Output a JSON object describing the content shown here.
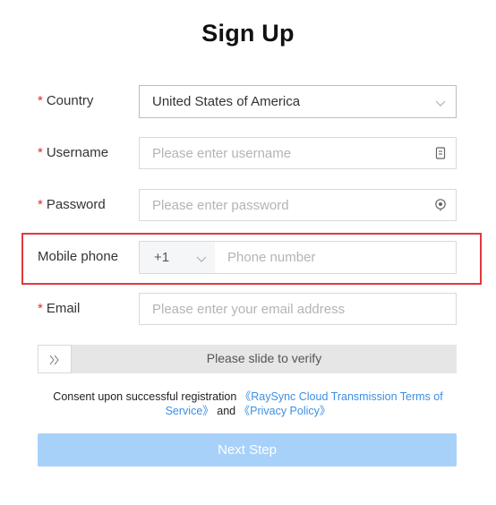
{
  "title": "Sign Up",
  "form": {
    "country": {
      "required_mark": "*",
      "label": "Country",
      "value": "United States of America"
    },
    "username": {
      "required_mark": "*",
      "label": "Username",
      "placeholder": "Please enter username"
    },
    "password": {
      "required_mark": "*",
      "label": "Password",
      "placeholder": "Please enter password"
    },
    "mobile": {
      "label": "Mobile phone",
      "country_code": "+1",
      "placeholder": "Phone number"
    },
    "email": {
      "required_mark": "*",
      "label": "Email",
      "placeholder": "Please enter your email address"
    }
  },
  "slider": {
    "handle_icon": "»",
    "text": "Please slide to verify"
  },
  "consent": {
    "prefix": "Consent upon successful registration",
    "terms_link": "《RaySync Cloud Transmission Terms of Service》",
    "and": "and",
    "privacy_link": "《Privacy Policy》"
  },
  "next_button": "Next Step",
  "colors": {
    "required": "#e02b2b",
    "link": "#3d8fe3",
    "button_disabled": "#a8d1fa",
    "highlight": "#e0393e"
  }
}
